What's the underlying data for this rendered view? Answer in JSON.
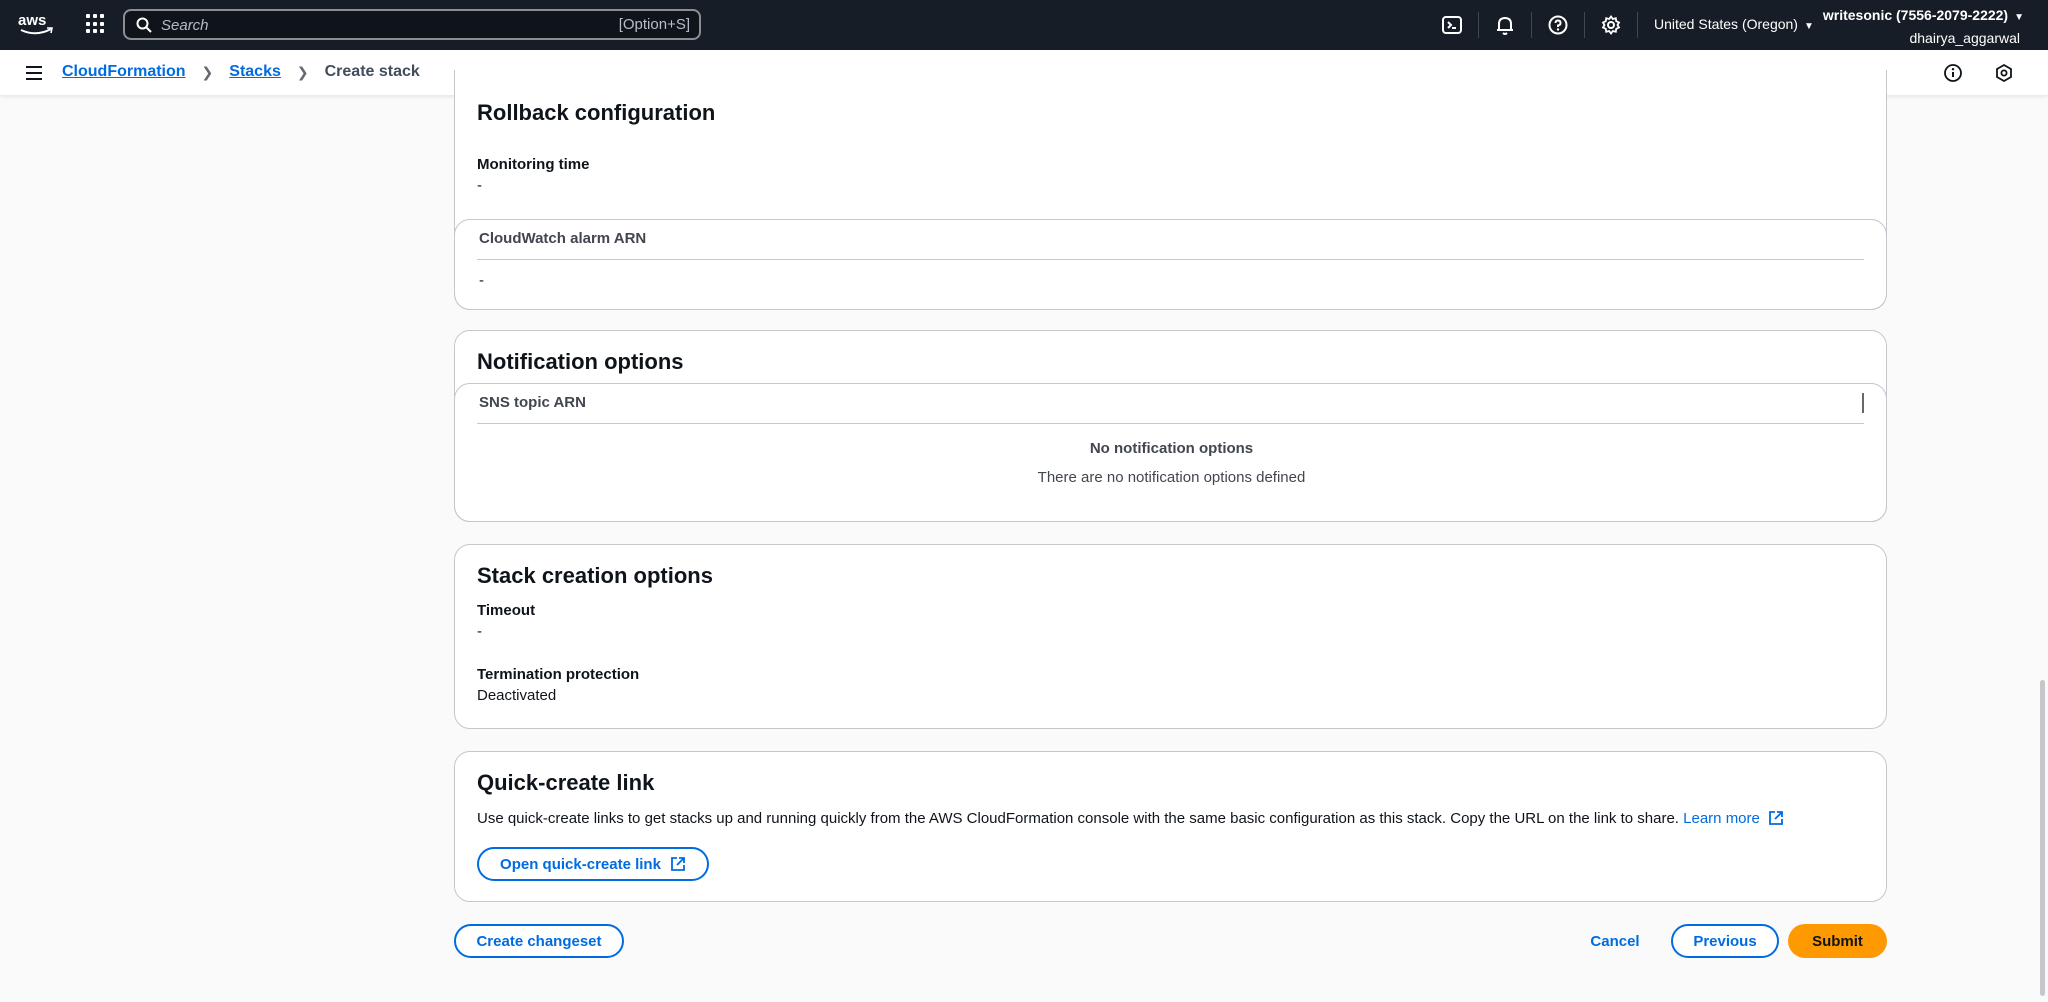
{
  "topnav": {
    "search_placeholder": "Search",
    "search_shortcut": "[Option+S]",
    "region": "United States (Oregon)",
    "account_name": "writesonic (7556-2079-2222)",
    "username": "dhairya_aggarwal",
    "icons": [
      "aws-logo",
      "apps-grid-icon",
      "search-icon",
      "cloudshell-icon",
      "bell-icon",
      "help-icon",
      "gear-icon"
    ]
  },
  "breadcrumb": {
    "items": [
      "CloudFormation",
      "Stacks"
    ],
    "current": "Create stack"
  },
  "rollback": {
    "title": "Rollback configuration",
    "monitoring_label": "Monitoring time",
    "monitoring_value": "-",
    "alarm_header": "CloudWatch alarm ARN",
    "alarm_value": "-"
  },
  "notifications": {
    "title": "Notification options",
    "column_header": "SNS topic ARN",
    "empty_title": "No notification options",
    "empty_text": "There are no notification options defined"
  },
  "stack_options": {
    "title": "Stack creation options",
    "timeout_label": "Timeout",
    "timeout_value": "-",
    "termination_label": "Termination protection",
    "termination_value": "Deactivated"
  },
  "quick_create": {
    "title": "Quick-create link",
    "description": "Use quick-create links to get stacks up and running quickly from the AWS CloudFormation console with the same basic configuration as this stack. Copy the URL on the link to share.",
    "learn_more": "Learn more",
    "open_button": "Open quick-create link"
  },
  "footer": {
    "create_changeset": "Create changeset",
    "cancel": "Cancel",
    "previous": "Previous",
    "submit": "Submit"
  },
  "colors": {
    "nav_bg": "#161d26",
    "link": "#006ce0",
    "primary": "#ff9900"
  }
}
